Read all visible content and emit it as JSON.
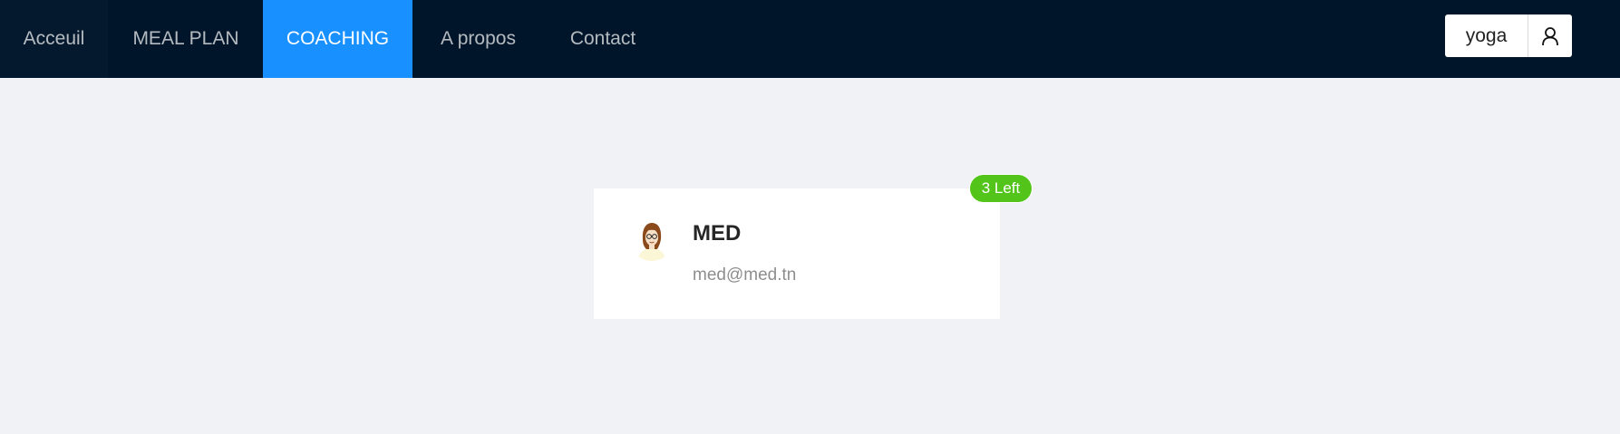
{
  "nav": {
    "items": [
      {
        "label": "Acceuil"
      },
      {
        "label": "MEAL PLAN"
      },
      {
        "label": "COACHING"
      },
      {
        "label": "A propos"
      },
      {
        "label": "Contact"
      }
    ],
    "active_item": "COACHING"
  },
  "user": {
    "name": "yoga",
    "icon": "user-icon"
  },
  "coach_card": {
    "badge": "3 Left",
    "name": "MED",
    "email": "med@med.tn",
    "avatar_icon": "avatar-illustration-icon"
  },
  "colors": {
    "navbar_bg": "#001529",
    "active_tab": "#1890ff",
    "badge_green": "#52c41a",
    "page_bg": "#f0f2f5"
  }
}
